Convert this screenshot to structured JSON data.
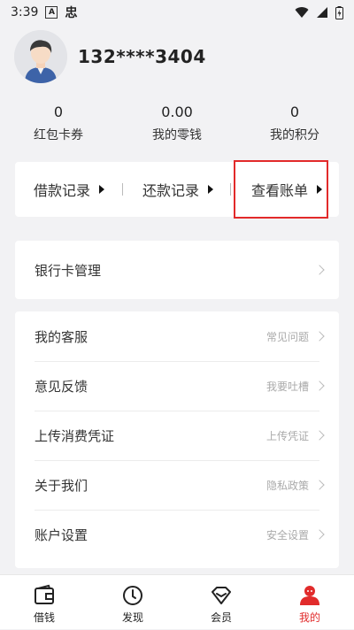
{
  "status_bar": {
    "time": "3:39",
    "a_badge": "A",
    "app_glyph": "忠"
  },
  "profile": {
    "phone": "132****3404"
  },
  "stats": [
    {
      "value": "0",
      "label": "红包卡券"
    },
    {
      "value": "0.00",
      "label": "我的零钱"
    },
    {
      "value": "0",
      "label": "我的积分"
    }
  ],
  "records": [
    {
      "label": "借款记录"
    },
    {
      "label": "还款记录"
    },
    {
      "label": "查看账单"
    }
  ],
  "bank_card": {
    "label": "银行卡管理"
  },
  "menu": [
    {
      "label": "我的客服",
      "hint": "常见问题"
    },
    {
      "label": "意见反馈",
      "hint": "我要吐槽"
    },
    {
      "label": "上传消费凭证",
      "hint": "上传凭证"
    },
    {
      "label": "关于我们",
      "hint": "隐私政策"
    },
    {
      "label": "账户设置",
      "hint": "安全设置"
    }
  ],
  "bottom_nav": [
    {
      "label": "借钱",
      "icon": "wallet-icon"
    },
    {
      "label": "发现",
      "icon": "compass-icon"
    },
    {
      "label": "会员",
      "icon": "diamond-icon"
    },
    {
      "label": "我的",
      "icon": "profile-icon",
      "active": true
    }
  ],
  "colors": {
    "accent": "#e12b2b",
    "highlight_box": "#e22a2a",
    "background": "#f2f2f4"
  }
}
